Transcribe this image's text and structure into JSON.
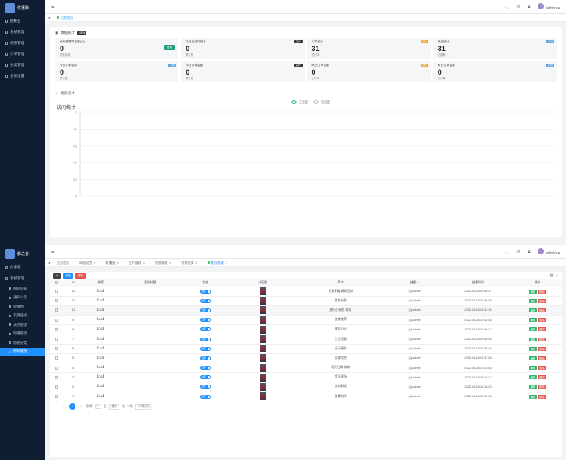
{
  "p1": {
    "brand": "优惠购",
    "menu": [
      {
        "label": "控制台"
      },
      {
        "label": "系统管理"
      },
      {
        "label": "权限管理"
      },
      {
        "label": "订单管理"
      },
      {
        "label": "分类管理"
      },
      {
        "label": "会员设置"
      }
    ],
    "tab": "后台首页",
    "user": "admin",
    "section": "数据统计",
    "section_badge": "NEW",
    "cards": [
      {
        "title": "优化管理员金额(元)",
        "value": "0",
        "sub": "累积余额",
        "tag": "",
        "button": "提现"
      },
      {
        "title": "今日已支付统计",
        "value": "0",
        "sub": "累计数",
        "tag": "实时",
        "button": ""
      },
      {
        "title": "订单统计",
        "value": "31",
        "sub": "总订单",
        "tag": "实时",
        "button": ""
      },
      {
        "title": "商品统计",
        "value": "31",
        "sub": "全部数",
        "tag": "实时",
        "button": ""
      },
      {
        "title": "今日订单金额",
        "value": "0",
        "sub": "累计数",
        "tag": "实时",
        "button": ""
      },
      {
        "title": "今日订单金额",
        "value": "0",
        "sub": "累计数",
        "tag": "实时",
        "button": ""
      },
      {
        "title": "昨日订单金额",
        "value": "0",
        "sub": "已订单",
        "tag": "实时",
        "button": ""
      },
      {
        "title": "昨日订单金额",
        "value": "0",
        "sub": "已订单",
        "tag": "实时",
        "button": ""
      }
    ],
    "card_tag_colors": [
      "#5aa0e8",
      "#333333",
      "#f0a020",
      "#5aa0e8",
      "#5aa0e8",
      "#333333",
      "#f0a020",
      "#5aa0e8"
    ],
    "chart_section": "图表统计",
    "chart_title": "访问统计",
    "legend": [
      "订单数",
      "访问数"
    ]
  },
  "chart_data": {
    "type": "line",
    "title": "访问统计",
    "series": [
      {
        "name": "订单数",
        "values": []
      },
      {
        "name": "访问数",
        "values": []
      }
    ],
    "yticks": [
      "1",
      "0.8",
      "0.6",
      "0.4",
      "0.2",
      "0"
    ],
    "ylim": [
      0,
      1
    ],
    "grid": true,
    "legend_position": "top-center"
  },
  "p2": {
    "brand": "影之音",
    "menu_top": [
      {
        "label": "仪表盘"
      },
      {
        "label": "系统管理"
      }
    ],
    "submenu": [
      {
        "label": "网站设置"
      },
      {
        "label": "通知公告"
      },
      {
        "label": "轮播图"
      },
      {
        "label": "友情链接"
      },
      {
        "label": "支付管理"
      },
      {
        "label": "轮播管理"
      },
      {
        "label": "影视分类"
      },
      {
        "label": "影片管理"
      }
    ],
    "tabs": [
      "后台首页",
      "网站设置",
      "轮播图",
      "支付管理",
      "轮播管理",
      "影视分类",
      "影视管理"
    ],
    "user": "admin",
    "toolbar": {
      "add": "添加",
      "delete": "删除"
    },
    "columns": [
      "ID",
      "排序",
      "视频标题",
      "状态",
      "封面图",
      "简介",
      "创建人",
      "创建时间",
      "操作"
    ],
    "rows": [
      {
        "id": "11",
        "sort": "【0/3】",
        "title": "",
        "status": "显示",
        "intro": "王者荣耀-精彩回顾",
        "creator": "(1)admin",
        "created": "2022-04-24 15:46:37"
      },
      {
        "id": "12",
        "sort": "【0/3】",
        "title": "",
        "status": "显示",
        "intro": "美妆分享",
        "creator": "(1)admin",
        "created": "2022-04-24 15:46:20"
      },
      {
        "id": "11",
        "sort": "【0/3】",
        "title": "",
        "status": "显示",
        "intro": "旅行小视频-推荐",
        "creator": "(1)admin",
        "created": "2022-04-24 15:41:35"
      },
      {
        "id": "9",
        "sort": "【0/3】",
        "title": "",
        "status": "显示",
        "intro": "美食推荐",
        "creator": "(1)admin",
        "created": "2022-04-24 15:42:08"
      },
      {
        "id": "8",
        "sort": "【0/3】",
        "title": "",
        "status": "显示",
        "intro": "健身日记",
        "creator": "(1)admin",
        "created": "2022-04-24 15:40:17"
      },
      {
        "id": "7",
        "sort": "【0/3】",
        "title": "",
        "status": "显示",
        "intro": "生活记录",
        "creator": "(1)admin",
        "created": "2022-04-24 15:40:08"
      },
      {
        "id": "6",
        "sort": "【0/3】",
        "title": "",
        "status": "显示",
        "intro": "运动精彩",
        "creator": "(1)admin",
        "created": "2022-04-24 15:39:48"
      },
      {
        "id": "5",
        "sort": "【0/3】",
        "title": "",
        "status": "显示",
        "intro": "风景欣赏",
        "creator": "(1)admin",
        "created": "2022-04-24 15:37:20"
      },
      {
        "id": "4",
        "sort": "【0/3】",
        "title": "",
        "status": "显示",
        "intro": "萌宠日常-搞笑",
        "creator": "(1)admin",
        "created": "2022-04-24 15:33:43"
      },
      {
        "id": "3",
        "sort": "【0/3】",
        "title": "",
        "status": "显示",
        "intro": "音乐现场",
        "creator": "(1)admin",
        "created": "2022-04-24 15:18:17"
      },
      {
        "id": "2",
        "sort": "【0/3】",
        "title": "",
        "status": "显示",
        "intro": "游戏解说",
        "creator": "(1)admin",
        "created": "2022-04-24 15:18:03"
      },
      {
        "id": "1",
        "sort": "【0/3】",
        "title": "",
        "status": "显示",
        "intro": "美食制作",
        "creator": "(1)admin",
        "created": "2022-04-24 15:12:56"
      }
    ],
    "row_actions": {
      "edit": "编辑",
      "delete": "删除"
    },
    "pager": {
      "current": "1",
      "goto_label": "到第",
      "page_field": "1",
      "page_unit": "页",
      "confirm": "确定",
      "total": "共 12 条",
      "per_page": "10 条/页"
    }
  }
}
